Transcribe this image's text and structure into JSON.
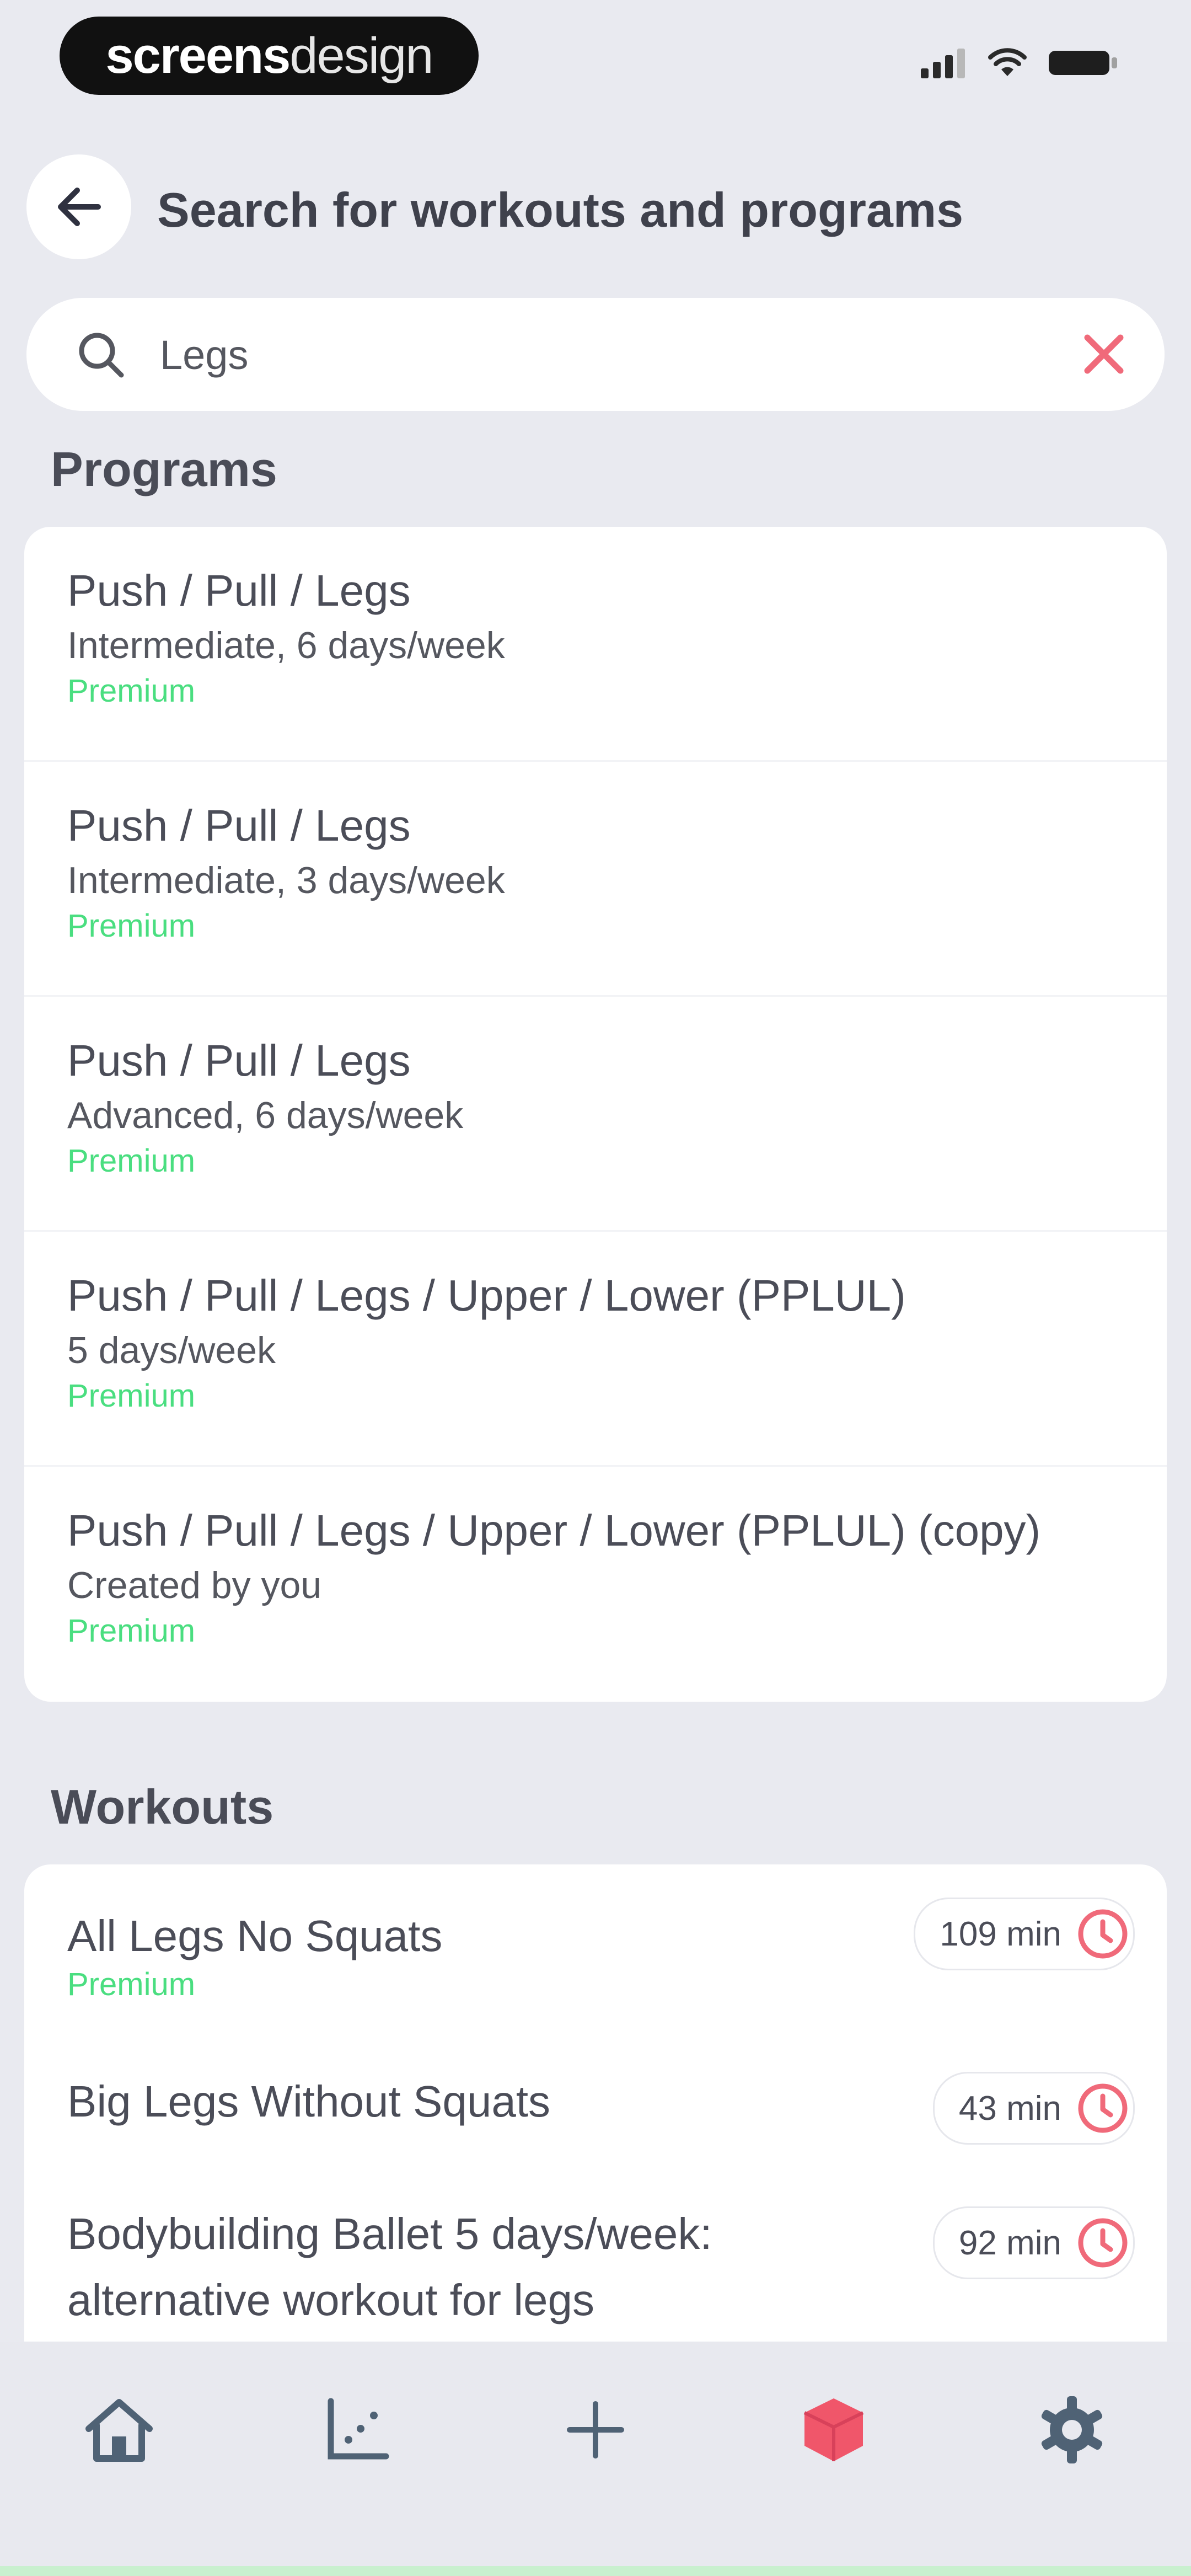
{
  "status_bar": {
    "brand_bold": "screens",
    "brand_light": "design",
    "icons": [
      "signal-icon",
      "wifi-icon",
      "battery-icon"
    ]
  },
  "header": {
    "title": "Search for workouts and programs",
    "back_icon": "arrow-left-icon"
  },
  "search": {
    "value": "Legs",
    "placeholder": "",
    "clear_icon": "close-icon"
  },
  "programs": {
    "title": "Programs",
    "items": [
      {
        "name": "Push / Pull / Legs",
        "sub": "Intermediate, 6 days/week",
        "tag": "Premium"
      },
      {
        "name": "Push / Pull / Legs",
        "sub": "Intermediate, 3 days/week",
        "tag": "Premium"
      },
      {
        "name": "Push / Pull / Legs",
        "sub": "Advanced, 6 days/week",
        "tag": "Premium"
      },
      {
        "name": "Push / Pull / Legs / Upper / Lower (PPLUL)",
        "sub": "5 days/week",
        "tag": "Premium"
      },
      {
        "name": "Push / Pull / Legs / Upper / Lower (PPLUL) (copy)",
        "sub": "Created by you",
        "tag": "Premium"
      }
    ]
  },
  "workouts": {
    "title": "Workouts",
    "items": [
      {
        "name": "All Legs No Squats",
        "tag": "Premium",
        "duration": "109 min"
      },
      {
        "name": "Big Legs Without Squats",
        "tag": "",
        "duration": "43 min"
      },
      {
        "name_line1": "Bodybuilding Ballet 5 days/week:",
        "name_line2": "alternative workout for legs",
        "duration": "92 min"
      }
    ]
  },
  "tab_bar": {
    "tabs": [
      "home-icon",
      "chart-icon",
      "plus-icon",
      "cube-icon",
      "gear-icon"
    ],
    "active": "cube-icon"
  },
  "colors": {
    "accent": "#f06a7a",
    "premium": "#4ade80",
    "background": "#e9eaf0",
    "card": "#ffffff"
  }
}
